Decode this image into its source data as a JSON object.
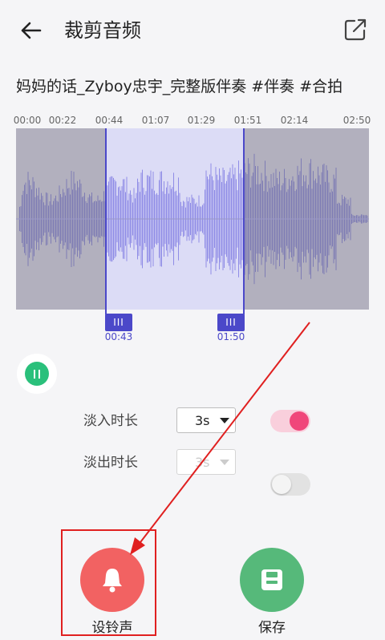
{
  "header": {
    "title": "裁剪音频",
    "back_icon": "arrow-left-icon",
    "share_icon": "share-external-icon"
  },
  "song_title": "妈妈的话_Zyboy忠宇_完整版伴奏 #伴奏 #合拍",
  "timeline": {
    "ticks": [
      "00:00",
      "00:22",
      "00:44",
      "01:07",
      "01:29",
      "01:51",
      "02:14",
      "02:50"
    ]
  },
  "selection": {
    "start_label": "00:43",
    "end_label": "01:50",
    "handle_glyph": "III"
  },
  "fade_in": {
    "label": "淡入时长",
    "value": "3s",
    "enabled": true
  },
  "fade_out": {
    "label": "淡出时长",
    "value": "3s",
    "enabled": false
  },
  "actions": {
    "ringtone_label": "设铃声",
    "save_label": "保存"
  },
  "colors": {
    "accent": "#4b48c9",
    "play": "#2ac07b",
    "ringtone": "#f26262",
    "save": "#56b97a",
    "toggle_on": "#f0467a",
    "annotation": "#e02020"
  }
}
